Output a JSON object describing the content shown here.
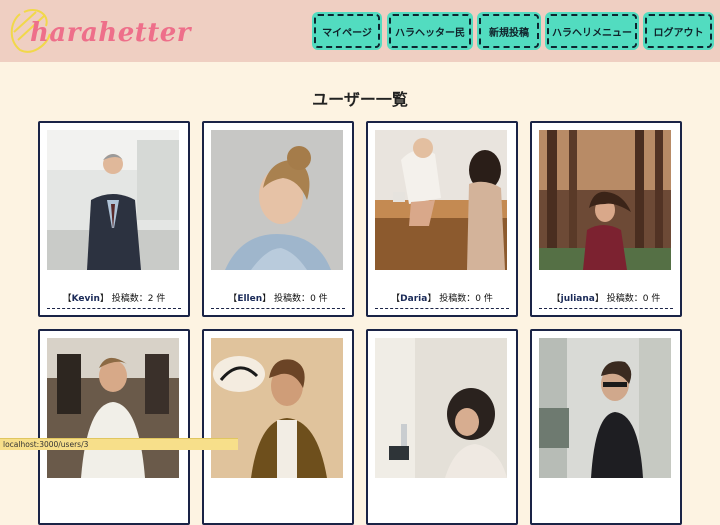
{
  "header": {
    "logo_text": "harahetter",
    "nav": [
      {
        "label": "マイページ"
      },
      {
        "label": "ハラヘッター民"
      },
      {
        "label": "新規投稿"
      },
      {
        "label": "ハラヘリメニュー"
      },
      {
        "label": "ログアウト"
      }
    ]
  },
  "main": {
    "title": "ユーザー一覧",
    "users": [
      {
        "name": "Kevin",
        "bracket_open": "【",
        "bracket_close": "】",
        "posts_label": "投稿数：",
        "posts": "2",
        "unit": "件"
      },
      {
        "name": "Ellen",
        "bracket_open": "【",
        "bracket_close": "】",
        "posts_label": "投稿数：",
        "posts": "0",
        "unit": "件"
      },
      {
        "name": "Daria",
        "bracket_open": "【",
        "bracket_close": "】",
        "posts_label": "投稿数：",
        "posts": "0",
        "unit": "件"
      },
      {
        "name": "juliana",
        "bracket_open": "【",
        "bracket_close": "】",
        "posts_label": "投稿数：",
        "posts": "0",
        "unit": "件"
      }
    ]
  },
  "status_bar": {
    "url": "localhost:3000/users/3"
  },
  "colors": {
    "header_bg": "#efcfc2",
    "page_bg": "#fdf3e2",
    "nav_btn_bg": "#52dcc0",
    "logo_pink": "#ee6f8a",
    "card_border": "#1a2346"
  }
}
